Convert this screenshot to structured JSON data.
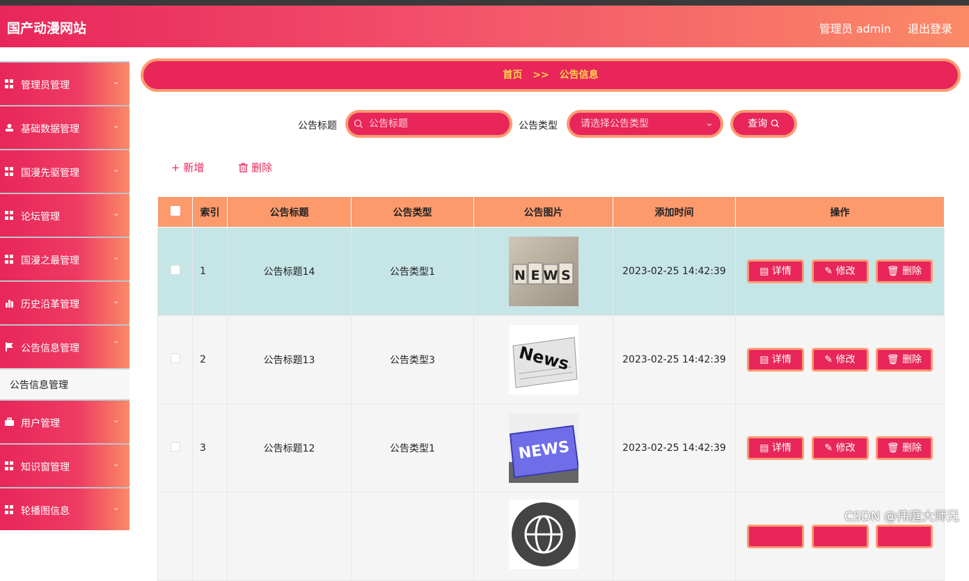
{
  "header": {
    "brand": "国产动漫网站",
    "user": "管理员 admin",
    "logout": "退出登录"
  },
  "sidebar": {
    "items": [
      {
        "label": "管理员管理",
        "icon": "grid-icon"
      },
      {
        "label": "基础数据管理",
        "icon": "user-icon"
      },
      {
        "label": "国漫先驱管理",
        "icon": "grid-icon"
      },
      {
        "label": "论坛管理",
        "icon": "grid-icon"
      },
      {
        "label": "国漫之最管理",
        "icon": "grid-icon"
      },
      {
        "label": "历史沿革管理",
        "icon": "bar-chart-icon"
      },
      {
        "label": "公告信息管理",
        "icon": "flag-icon"
      },
      {
        "label": "用户管理",
        "icon": "briefcase-icon"
      },
      {
        "label": "知识窗管理",
        "icon": "grid-icon"
      },
      {
        "label": "轮播图信息",
        "icon": "grid-icon"
      }
    ],
    "sub_item": "公告信息管理"
  },
  "breadcrumb": {
    "home": "首页",
    "sep": ">>",
    "current": "公告信息"
  },
  "search": {
    "title_label": "公告标题",
    "title_placeholder": "公告标题",
    "type_label": "公告类型",
    "type_placeholder": "请选择公告类型",
    "query_button": "查询"
  },
  "actions": {
    "add": "新增",
    "delete": "删除"
  },
  "table": {
    "headers": [
      "索引",
      "公告标题",
      "公告类型",
      "公告图片",
      "添加时间",
      "操作"
    ],
    "rows": [
      {
        "index": "1",
        "title": "公告标题14",
        "type": "公告类型1",
        "time": "2023-02-25 14:42:39",
        "image": "NEWS"
      },
      {
        "index": "2",
        "title": "公告标题13",
        "type": "公告类型3",
        "time": "2023-02-25 14:42:39",
        "image": "News"
      },
      {
        "index": "3",
        "title": "公告标题12",
        "type": "公告类型1",
        "time": "2023-02-25 14:42:39",
        "image": "NEWS"
      }
    ],
    "op_detail": "详情",
    "op_edit": "修改",
    "op_delete": "删除"
  },
  "watermark": "CSDN @伟庭大师兄",
  "colors": {
    "primary": "#e8265a",
    "accent": "#fb9a72",
    "highlight_row": "#c6e5e6",
    "crumb_text": "#ffd54a"
  }
}
